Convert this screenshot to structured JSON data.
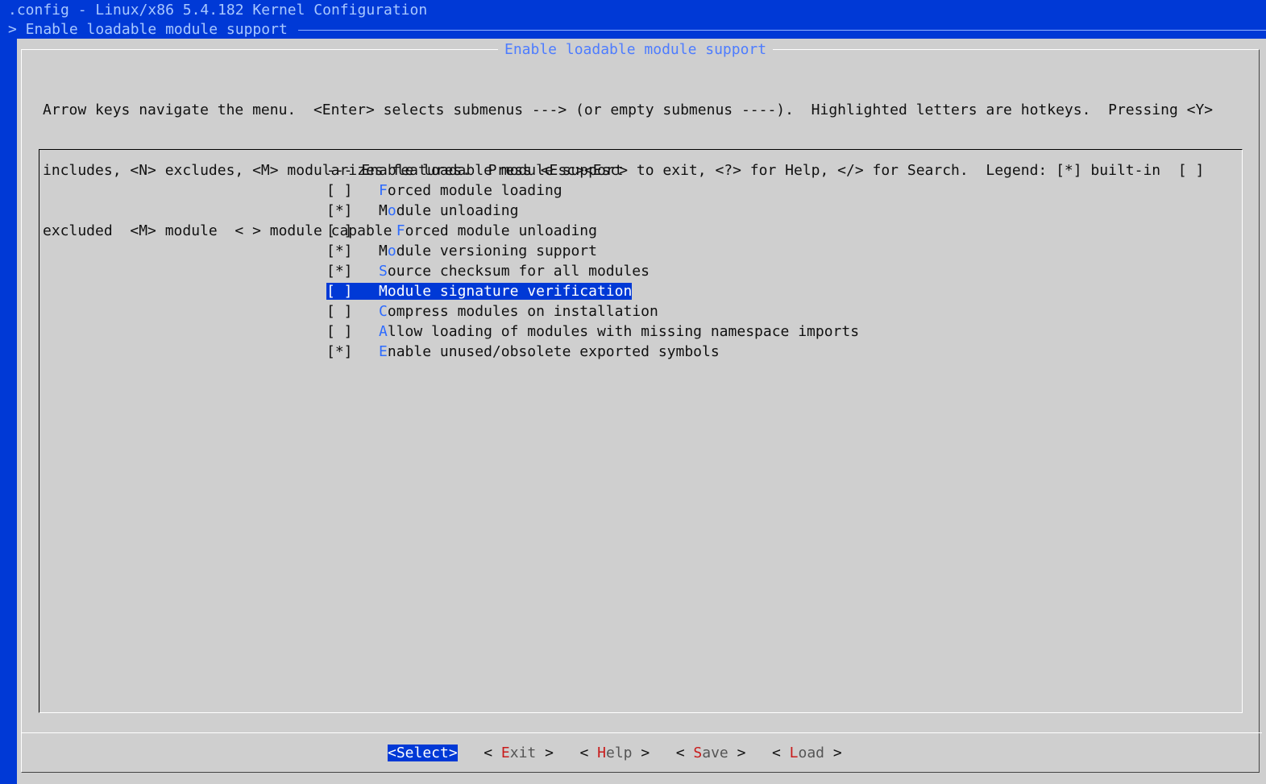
{
  "window": {
    "title": ".config - Linux/x86 5.4.182 Kernel Configuration",
    "breadcrumb": "> Enable loadable module support"
  },
  "dialog": {
    "title": "Enable loadable module support",
    "help_lines": [
      "Arrow keys navigate the menu.  <Enter> selects submenus ---> (or empty submenus ----).  Highlighted letters are hotkeys.  Pressing <Y>",
      "includes, <N> excludes, <M> modularizes features.  Press <Esc><Esc> to exit, <?> for Help, </> for Search.  Legend: [*] built-in  [ ]",
      "excluded  <M> module  < > module capable"
    ]
  },
  "menu": {
    "header": "--- Enable loadable module support",
    "items": [
      {
        "state": "[ ]",
        "indent": "",
        "hotkey": "F",
        "rest": "orced module loading",
        "pre": ""
      },
      {
        "state": "[*]",
        "indent": "",
        "pre": "M",
        "hotkey": "o",
        "rest": "dule unloading"
      },
      {
        "state": "[ ]",
        "indent": "  ",
        "hotkey": "F",
        "rest": "orced module unloading",
        "pre": ""
      },
      {
        "state": "[*]",
        "indent": "",
        "pre": "M",
        "hotkey": "o",
        "rest": "dule versioning support"
      },
      {
        "state": "[*]",
        "indent": "",
        "hotkey": "S",
        "rest": "ource checksum for all modules",
        "pre": ""
      },
      {
        "state": "[ ]",
        "indent": "",
        "hotkey": "M",
        "rest": "odule signature verification",
        "pre": "",
        "selected": true
      },
      {
        "state": "[ ]",
        "indent": "",
        "hotkey": "C",
        "rest": "ompress modules on installation",
        "pre": ""
      },
      {
        "state": "[ ]",
        "indent": "",
        "hotkey": "A",
        "rest": "llow loading of modules with missing namespace imports",
        "pre": ""
      },
      {
        "state": "[*]",
        "indent": "",
        "hotkey": "E",
        "rest": "nable unused/obsolete exported symbols",
        "pre": ""
      }
    ]
  },
  "buttons": {
    "select": "<Select>",
    "exit": {
      "hotkey": "E",
      "rest": "xit"
    },
    "help": {
      "hotkey": "H",
      "rest": "elp"
    },
    "save": {
      "hotkey": "S",
      "rest": "ave"
    },
    "load": {
      "hotkey": "L",
      "rest": "oad"
    }
  },
  "colors": {
    "background": "#0039d6",
    "dialog": "#cfcfcf",
    "hotkey": "#2d6bff",
    "button_hotkey": "#c81b1b",
    "selection": "#0039d6"
  }
}
